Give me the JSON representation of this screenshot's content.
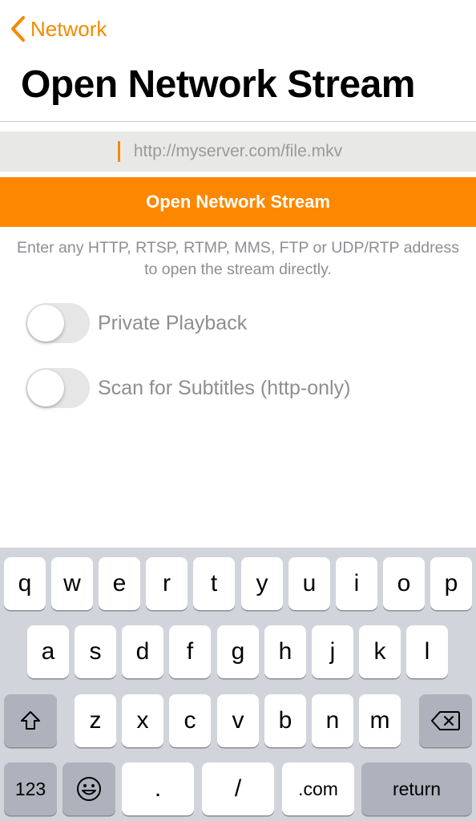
{
  "nav": {
    "back_label": "Network"
  },
  "page": {
    "title": "Open Network Stream"
  },
  "url_field": {
    "value": "",
    "placeholder": "http://myserver.com/file.mkv"
  },
  "open_button": {
    "label": "Open Network Stream"
  },
  "help_text": "Enter any HTTP, RTSP, RTMP, MMS, FTP or UDP/RTP address to open the stream directly.",
  "options": [
    {
      "label": "Private Playback",
      "enabled": false
    },
    {
      "label": "Scan for Subtitles (http-only)",
      "enabled": false
    }
  ],
  "keyboard": {
    "row1": [
      "q",
      "w",
      "e",
      "r",
      "t",
      "y",
      "u",
      "i",
      "o",
      "p"
    ],
    "row2": [
      "a",
      "s",
      "d",
      "f",
      "g",
      "h",
      "j",
      "k",
      "l"
    ],
    "row3": [
      "z",
      "x",
      "c",
      "v",
      "b",
      "n",
      "m"
    ],
    "shift_icon": "shift-arrow-icon",
    "delete_icon": "backspace-icon",
    "numbers_label": "123",
    "emoji_icon": "emoji-icon",
    "period_label": ".",
    "slash_label": "/",
    "dotcom_label": ".com",
    "return_label": "return"
  },
  "colors": {
    "accent": "#fd8800",
    "back_tint": "#f28a00",
    "secondary_text": "#8e8e93",
    "keyboard_bg": "#d1d4db"
  }
}
